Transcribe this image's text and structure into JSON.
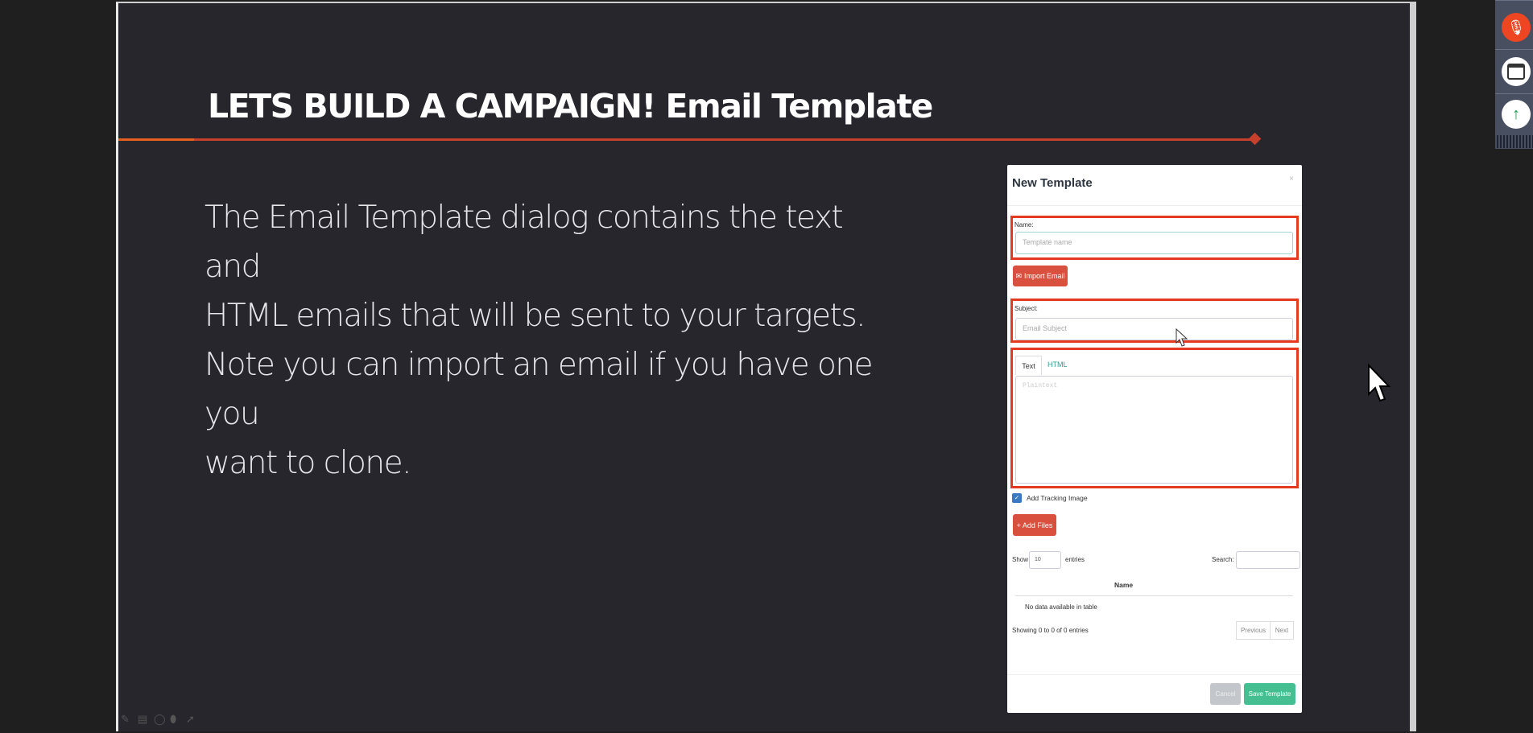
{
  "slide": {
    "title": "LETS BUILD A CAMPAIGN! Email Template",
    "body_lines": [
      "The Email Template dialog contains the text and",
      "HTML emails that will be sent to your targets.",
      "Note you can import an email if you have one you",
      "want to clone."
    ],
    "accent_color": "#c6402b"
  },
  "dialog": {
    "title": "New Template",
    "close": "×",
    "name_label": "Name:",
    "name_placeholder": "Template name",
    "import_button": "Import Email",
    "subject_label": "Subject:",
    "subject_placeholder": "Email Subject",
    "tabs": [
      "Text",
      "HTML"
    ],
    "text_placeholder": "Plaintext",
    "tracking_label": "Add Tracking Image",
    "tracking_checked": true,
    "add_files_button": "Add Files",
    "show_label": "Show",
    "entries_value": "10",
    "entries_label": "entries",
    "search_label": "Search:",
    "column_header": "Name",
    "empty_text": "No data available in table",
    "info_text": "Showing 0 to 0 of 0 entries",
    "previous": "Previous",
    "next": "Next",
    "cancel": "Cancel",
    "save": "Save Template"
  },
  "side_panel": {
    "icons": [
      "mic-muted-icon",
      "window-icon",
      "raise-hand-icon"
    ]
  },
  "toolbar": {
    "icons": [
      "pen-icon",
      "slides-icon",
      "lasso-icon",
      "eraser-icon",
      "pointer-icon"
    ]
  }
}
